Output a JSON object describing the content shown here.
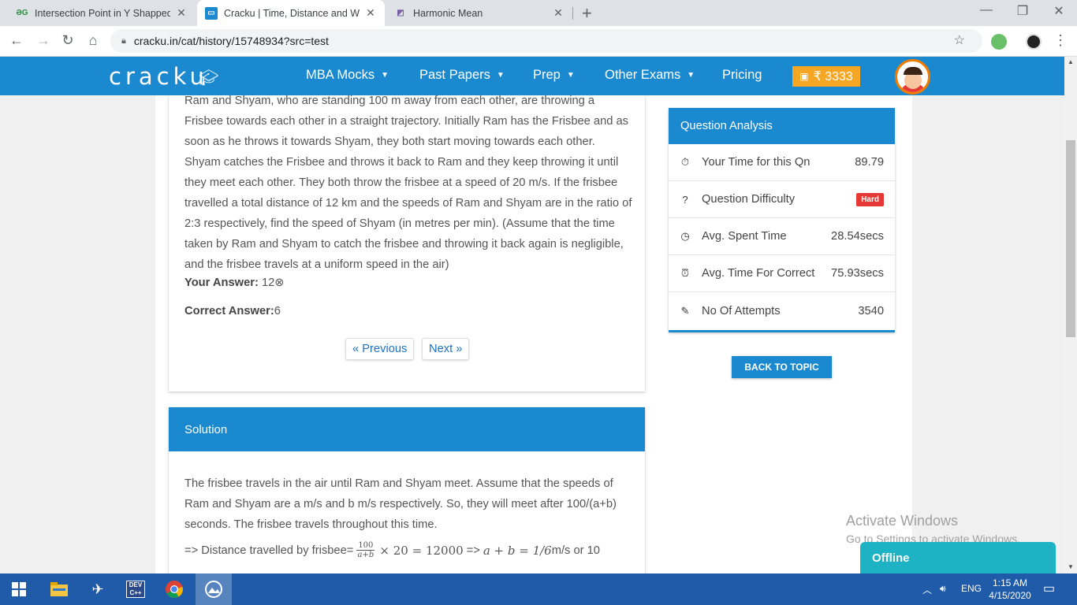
{
  "browser": {
    "tabs": [
      {
        "title": "Intersection Point in Y Shapped L",
        "favicon": "geeksforgeeks-icon"
      },
      {
        "title": "Cracku | Time, Distance and Work",
        "favicon": "cracku-icon"
      },
      {
        "title": "Harmonic Mean",
        "favicon": "harmonic-mean-icon"
      }
    ],
    "url": "cracku.in/cat/history/15748934?src=test"
  },
  "site": {
    "logo": "cracku",
    "nav": [
      "MBA Mocks",
      "Past Papers",
      "Prep",
      "Other Exams",
      "Pricing"
    ],
    "coins": "₹ 3333"
  },
  "question": {
    "text": "Ram and Shyam, who are standing 100 m away from each other, are throwing a Frisbee towards each other in a straight trajectory. Initially Ram has the Frisbee and as soon as he throws it towards Shyam, they both start moving towards each other. Shyam catches the Frisbee and throws it back to Ram and they keep throwing it until they meet each other. They both throw the frisbee at a speed of 20 m/s. If the frisbee travelled a total distance of 12 km and the speeds of Ram and Shyam are in the ratio of 2:3 respectively, find the speed of Shyam (in metres per min). (Assume that the time taken by Ram and Shyam to catch the frisbee and throwing it back again is negligible, and the frisbee travels at a uniform speed in the air)",
    "your_answer_label": "Your Answer:",
    "your_answer": "12",
    "correct_answer_label": "Correct Answer:",
    "correct_answer": "6",
    "prev": "« Previous",
    "next": "Next »"
  },
  "solution": {
    "title": "Solution",
    "text": "The frisbee travels in the air until Ram and Shyam meet. Assume that the speeds of Ram and Shyam are a m/s and b m/s respectively. So, they will meet after 100/(a+b) seconds. The frisbee travels throughout this time.",
    "math_prefix": "=> Distance travelled by frisbee=",
    "frac_num": "100",
    "frac_den": "a+b",
    "math_mid": "× 20 = 12000",
    "math_arrow": "=>",
    "math_eq": "a + b = 1/6",
    "math_suffix": "m/s or 10"
  },
  "analysis": {
    "title": "Question Analysis",
    "rows": [
      {
        "label": "Your Time for this Qn",
        "value": "89.79",
        "icon": "stopwatch-icon"
      },
      {
        "label": "Question Difficulty",
        "value": "Hard",
        "icon": "question-circle-icon"
      },
      {
        "label": "Avg. Spent Time",
        "value": "28.54secs",
        "icon": "clock-icon"
      },
      {
        "label": "Avg. Time For Correct",
        "value": "75.93secs",
        "icon": "alarm-icon"
      },
      {
        "label": "No Of Attempts",
        "value": "3540",
        "icon": "edit-icon"
      }
    ],
    "back": "BACK TO TOPIC"
  },
  "overlay": {
    "activate1": "Activate Windows",
    "activate2": "Go to Settings to activate Windows.",
    "offline": "Offline"
  },
  "taskbar": {
    "lang": "ENG",
    "time": "1:15 AM",
    "date": "4/15/2020"
  },
  "colors": {
    "brand": "#1a89cf",
    "coins": "#f5a623",
    "hard": "#e53935",
    "taskbar": "#1f5ba8"
  }
}
